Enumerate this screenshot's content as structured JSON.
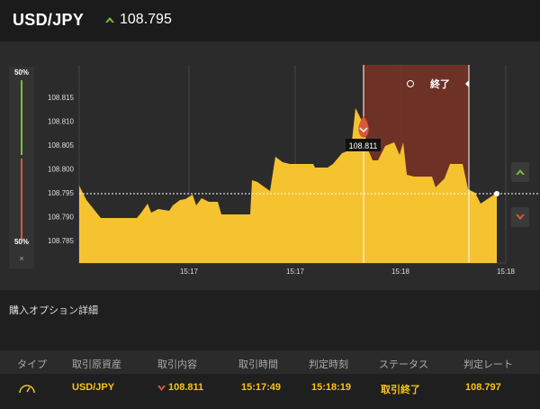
{
  "header": {
    "pair": "USD/JPY",
    "rate": "108.795"
  },
  "gauge": {
    "top": "50%",
    "bottom": "50%",
    "close": "×"
  },
  "chart_data": {
    "type": "area",
    "y_ticks": [
      "108.815",
      "108.810",
      "108.805",
      "108.800",
      "108.795",
      "108.790",
      "108.785"
    ],
    "x_ticks": [
      "15:17",
      "15:17",
      "15:18",
      "15:18"
    ],
    "current": "108.795",
    "marker": {
      "label": "108.811"
    },
    "expiry_label": "終了"
  },
  "section": {
    "title": "購入オプション詳細"
  },
  "table": {
    "headers": [
      "タイプ",
      "取引原資産",
      "取引内容",
      "取引時間",
      "判定時刻",
      "ステータス",
      "判定レート"
    ],
    "row": {
      "asset": "USD/JPY",
      "content": "108.811",
      "time": "15:17:49",
      "judge": "15:18:19",
      "status": "取引終了",
      "rate": "108.797"
    }
  }
}
